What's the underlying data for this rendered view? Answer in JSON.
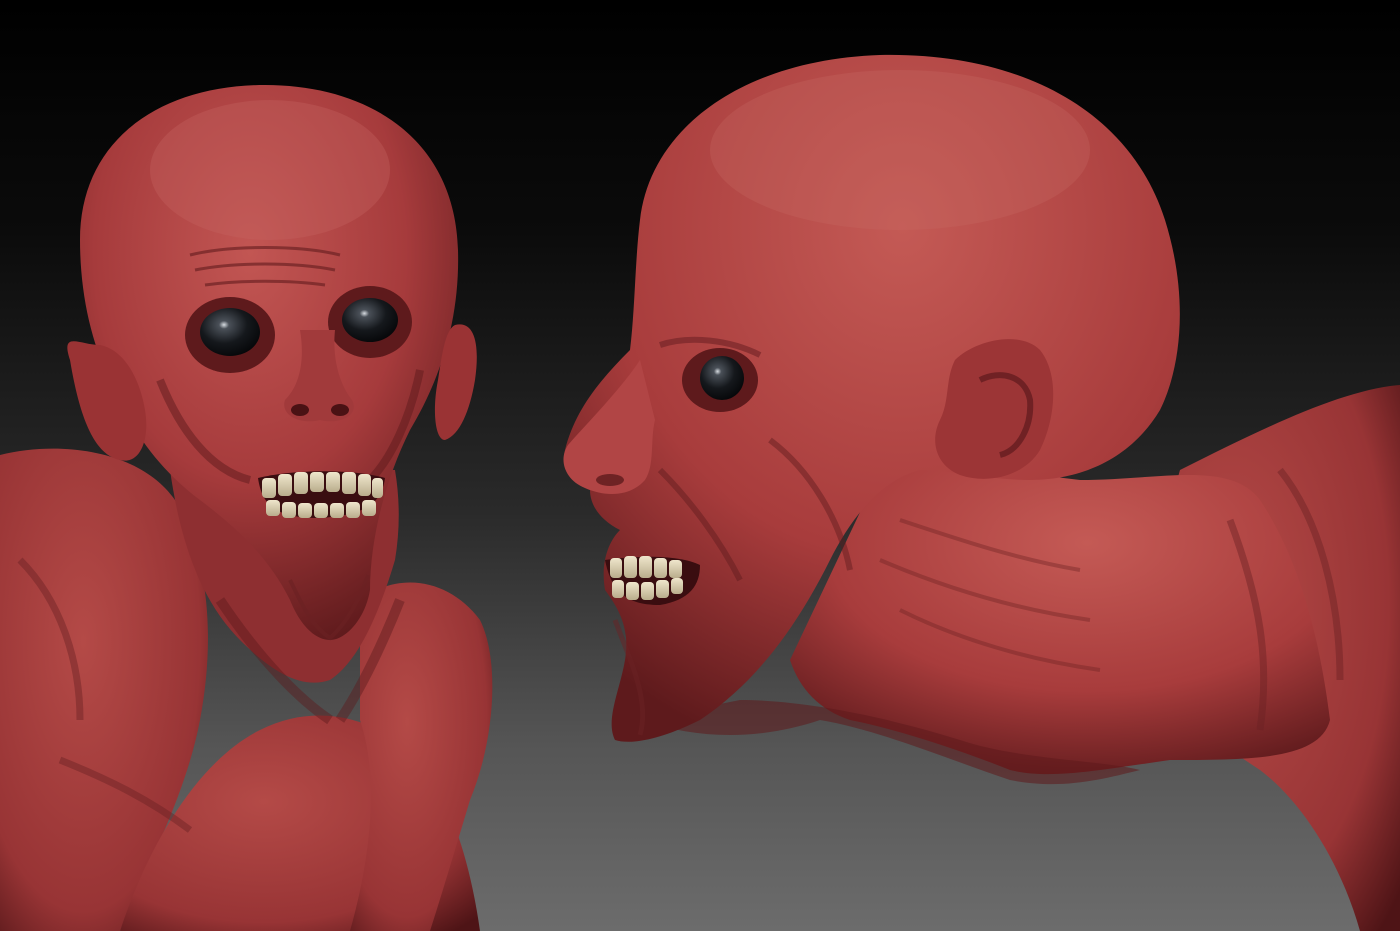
{
  "scene": {
    "subject": "sculpt-render",
    "views": [
      {
        "id": "front-view",
        "orientation": "front"
      },
      {
        "id": "side-view",
        "orientation": "profile-left"
      }
    ],
    "colors": {
      "skin": "#a83c3c",
      "skin_shadow": "#5e1a1c",
      "skin_highlight": "#c65a56",
      "teeth": "#d8cfb6",
      "eye": "#111418",
      "background_top": "#000000",
      "background_bottom": "#6c6c6c"
    }
  }
}
